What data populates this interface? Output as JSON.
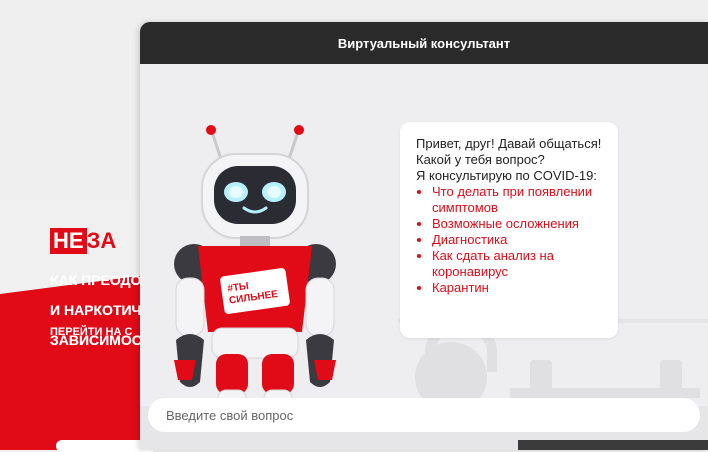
{
  "background_page": {
    "brand_ne": "НЕ",
    "brand_rest": "ЗА",
    "lines": [
      "КАК ПРЕОДО",
      "И НАРКОТИЧ",
      "ЗАВИСИМОС"
    ],
    "cta": "ПЕРЕЙТИ НА С"
  },
  "consultant": {
    "title": "Виртуальный консультант",
    "robot_badge": "#ТЫ СИЛЬНЕЕ",
    "message": {
      "greeting": "Привет, друг! Давай общаться! Какой у тебя вопрос?",
      "intro": "Я консультирую по COVID-19:",
      "topics": [
        "Что делать при появлении симптомов",
        "Возможные осложнения",
        "Диагностика",
        "Как сдать анализ на коронавирус",
        "Карантин"
      ]
    },
    "input": {
      "placeholder": "Введите свой вопрос",
      "value": ""
    }
  },
  "colors": {
    "accent_red": "#e10a17",
    "header_dark": "#2a2a2a"
  },
  "icons": [
    "robot-mascot-icon"
  ]
}
